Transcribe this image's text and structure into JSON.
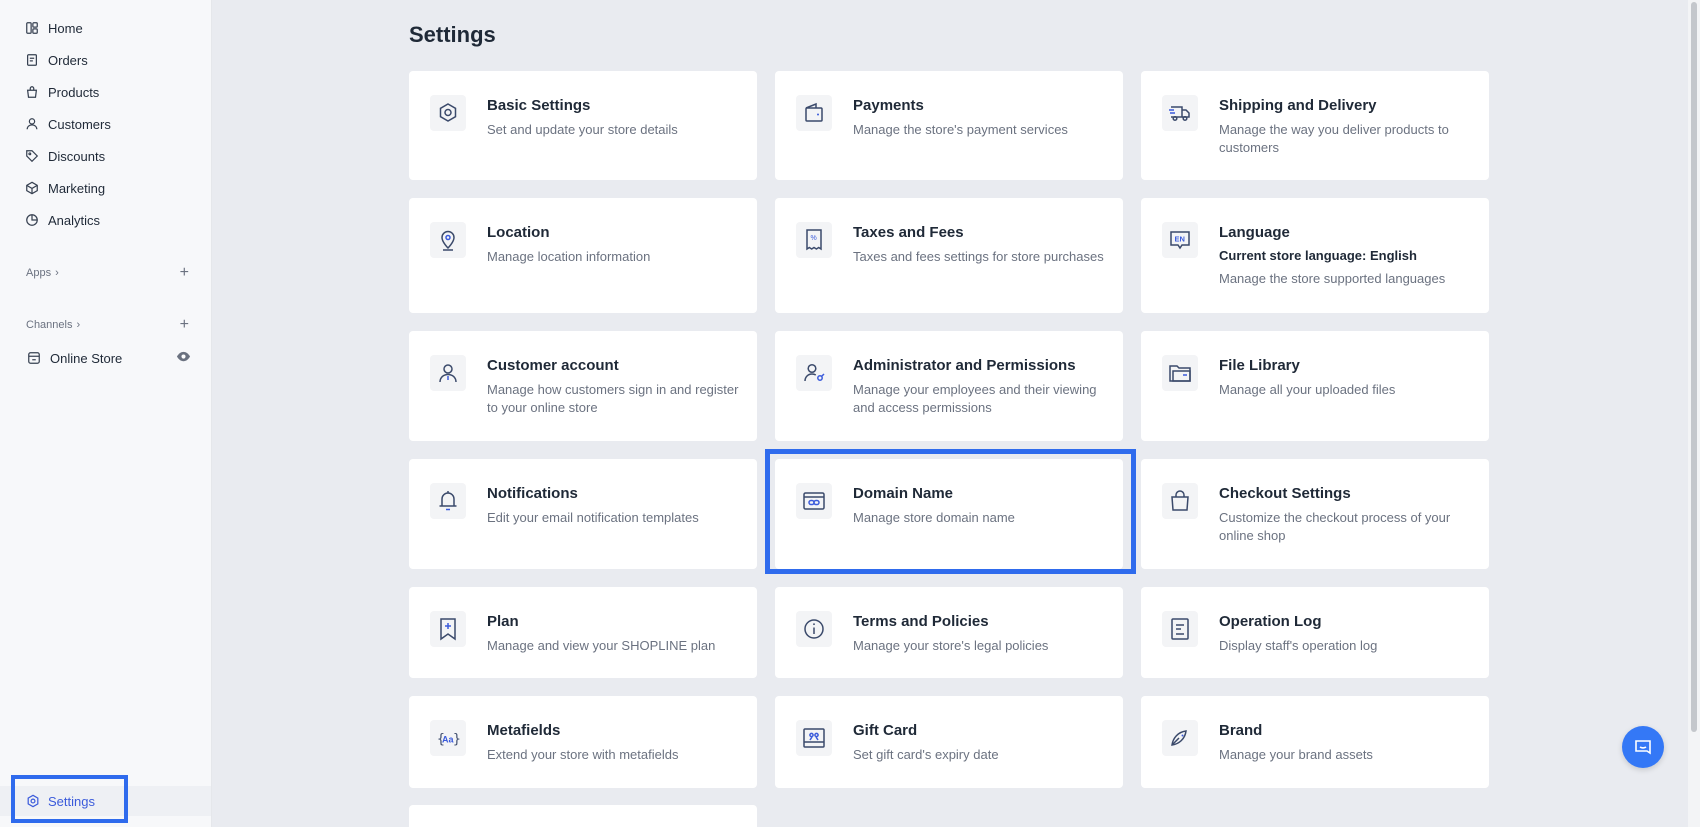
{
  "sidebar": {
    "nav": [
      {
        "label": "Home",
        "icon": "home-icon"
      },
      {
        "label": "Orders",
        "icon": "orders-icon"
      },
      {
        "label": "Products",
        "icon": "products-icon"
      },
      {
        "label": "Customers",
        "icon": "customers-icon"
      },
      {
        "label": "Discounts",
        "icon": "discounts-icon"
      },
      {
        "label": "Marketing",
        "icon": "marketing-icon"
      },
      {
        "label": "Analytics",
        "icon": "analytics-icon"
      }
    ],
    "apps_label": "Apps",
    "channels_label": "Channels",
    "channel": {
      "label": "Online Store",
      "icon": "store-icon"
    },
    "settings_label": "Settings"
  },
  "main": {
    "title": "Settings",
    "cards": [
      {
        "title": "Basic Settings",
        "desc": "Set and update your store details",
        "icon": "gear-icon"
      },
      {
        "title": "Payments",
        "desc": "Manage the store's payment services",
        "icon": "wallet-icon"
      },
      {
        "title": "Shipping and Delivery",
        "desc": "Manage the way you deliver products to customers",
        "icon": "truck-icon"
      },
      {
        "title": "Location",
        "desc": "Manage location information",
        "icon": "location-pin-icon"
      },
      {
        "title": "Taxes and Fees",
        "desc": "Taxes and fees settings for store purchases",
        "icon": "receipt-icon"
      },
      {
        "title": "Language",
        "strong": "Current store language: English",
        "desc": "Manage the store supported languages",
        "icon": "language-icon"
      },
      {
        "title": "Customer account",
        "desc": "Manage how customers sign in and register to your online store",
        "icon": "user-icon"
      },
      {
        "title": "Administrator and Permissions",
        "desc": "Manage your employees and their viewing and access permissions",
        "icon": "user-key-icon"
      },
      {
        "title": "File Library",
        "desc": "Manage all your uploaded files",
        "icon": "folder-icon"
      },
      {
        "title": "Notifications",
        "desc": "Edit your email notification templates",
        "icon": "bell-icon"
      },
      {
        "title": "Domain Name",
        "desc": "Manage store domain name",
        "icon": "domain-link-icon"
      },
      {
        "title": "Checkout Settings",
        "desc": "Customize the checkout process of your online shop",
        "icon": "shopping-bag-icon"
      },
      {
        "title": "Plan",
        "desc": "Manage and view your SHOPLINE plan",
        "icon": "plan-bookmark-icon"
      },
      {
        "title": "Terms and Policies",
        "desc": "Manage your store's legal policies",
        "icon": "info-icon"
      },
      {
        "title": "Operation Log",
        "desc": "Display staff's operation log",
        "icon": "log-icon"
      },
      {
        "title": "Metafields",
        "desc": "Extend your store with metafields",
        "icon": "metafields-icon"
      },
      {
        "title": "Gift Card",
        "desc": "Set gift card's expiry date",
        "icon": "gift-card-icon"
      },
      {
        "title": "Brand",
        "desc": "Manage your brand assets",
        "icon": "brand-icon"
      }
    ]
  },
  "colors": {
    "accent": "#3b5bdb",
    "highlight": "#2f6bed",
    "chat": "#3478f6"
  }
}
